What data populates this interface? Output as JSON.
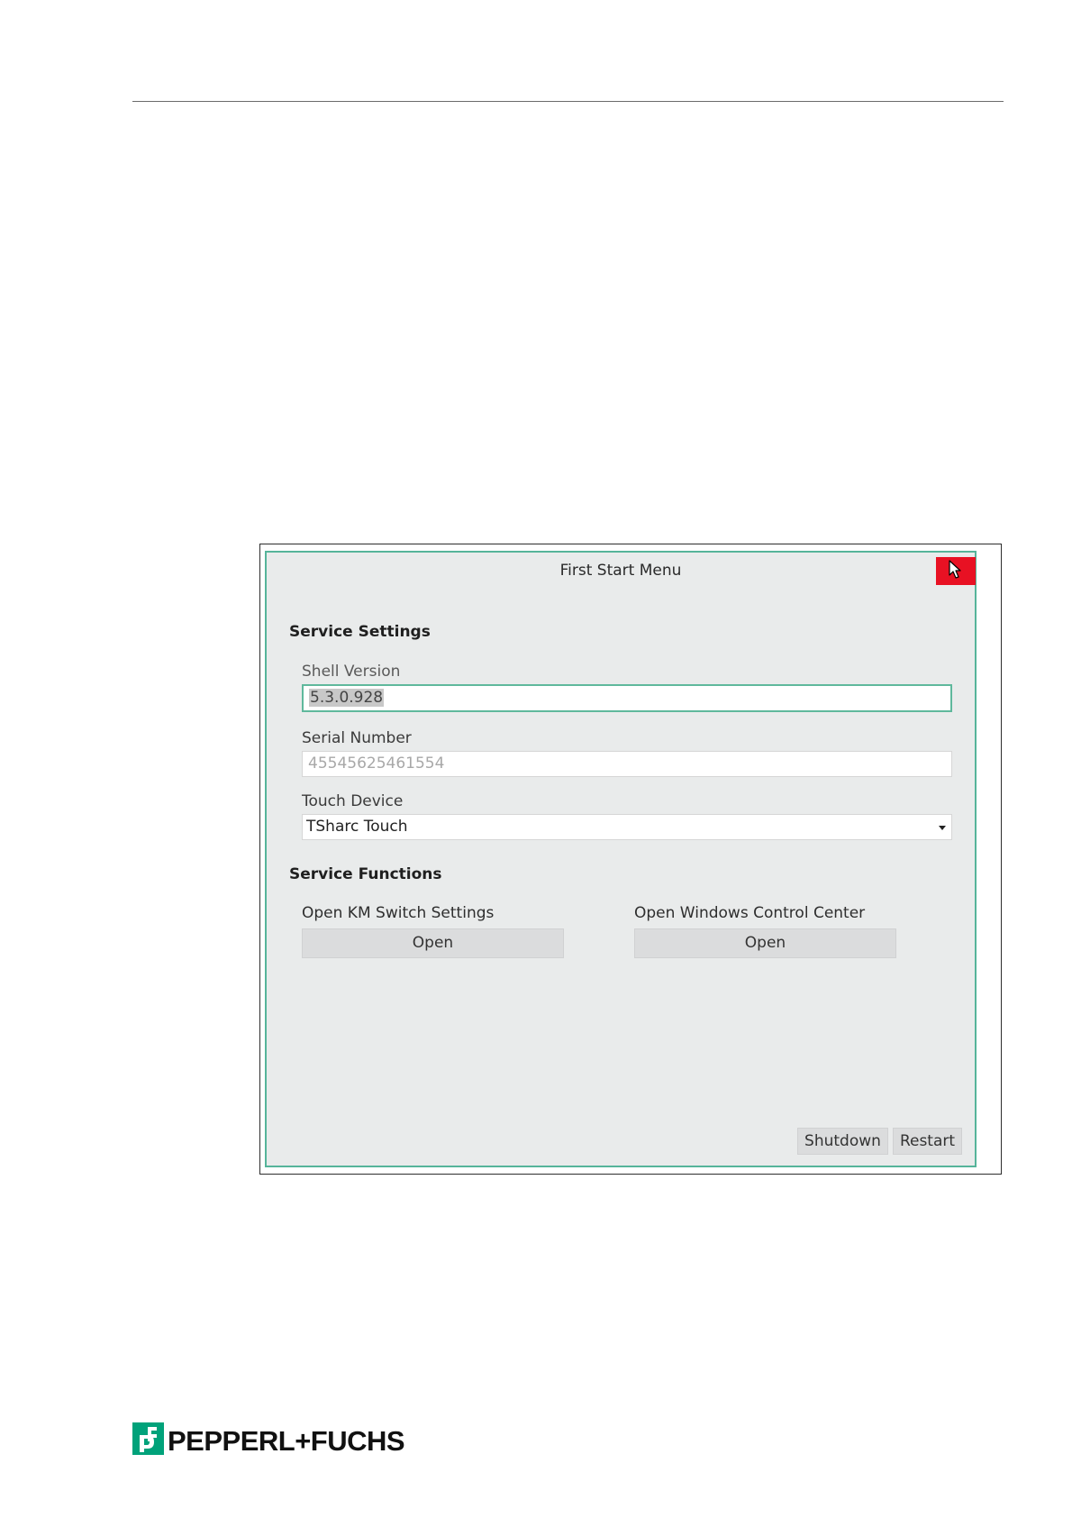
{
  "window": {
    "title": "First Start Menu"
  },
  "service_settings": {
    "heading": "Service Settings",
    "shell_version": {
      "label": "Shell Version",
      "value": "5.3.0.928"
    },
    "serial_number": {
      "label": "Serial Number",
      "value": "45545625461554"
    },
    "touch_device": {
      "label": "Touch Device",
      "selected": "TSharc Touch"
    }
  },
  "service_functions": {
    "heading": "Service Functions",
    "km_switch": {
      "label": "Open KM Switch Settings",
      "button": "Open"
    },
    "control_center": {
      "label": "Open Windows Control Center",
      "button": "Open"
    }
  },
  "footer": {
    "shutdown": "Shutdown",
    "restart": "Restart"
  },
  "brand": {
    "name": "PEPPERL+FUCHS",
    "color": "#00a27a"
  },
  "colors": {
    "window_border": "#56b49a",
    "close_button": "#e81123"
  }
}
